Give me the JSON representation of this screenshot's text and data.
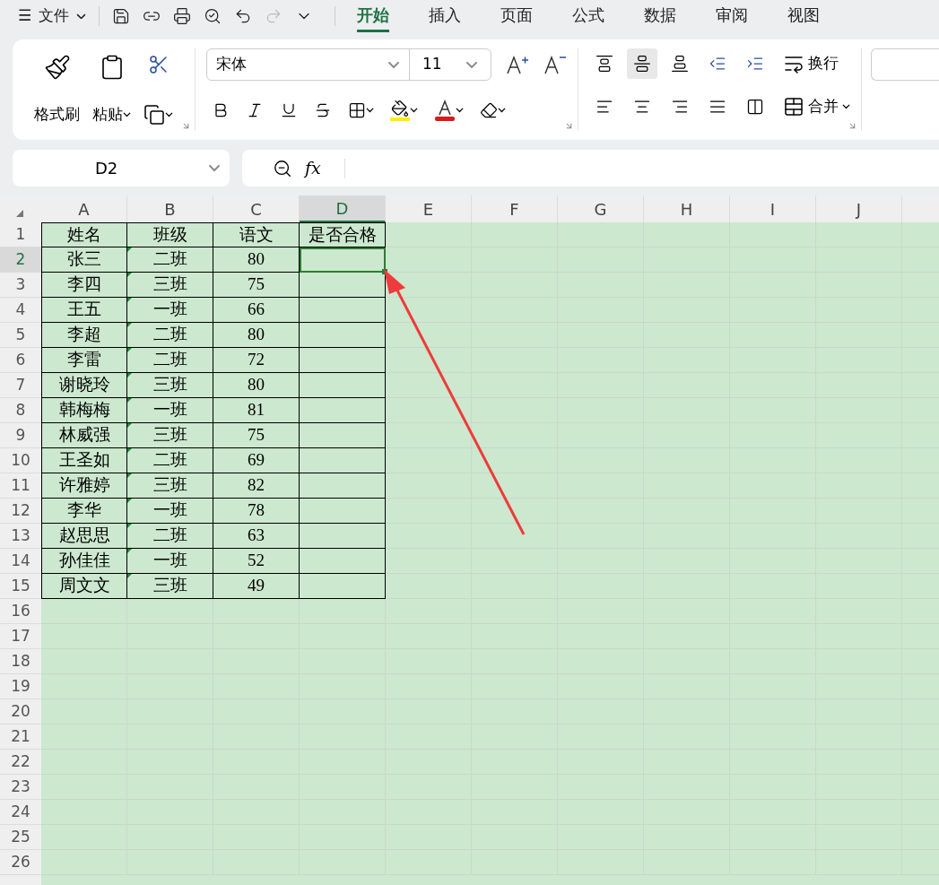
{
  "menu": {
    "menu_glyph": "☰",
    "file_label": "文件"
  },
  "tabs": [
    {
      "label": "开始",
      "selected": true
    },
    {
      "label": "插入",
      "selected": false
    },
    {
      "label": "页面",
      "selected": false
    },
    {
      "label": "公式",
      "selected": false
    },
    {
      "label": "数据",
      "selected": false
    },
    {
      "label": "审阅",
      "selected": false
    },
    {
      "label": "视图",
      "selected": false
    }
  ],
  "ribbon": {
    "format_painter": "格式刷",
    "paste": "粘贴",
    "font_name": "宋体",
    "font_size": "11",
    "wrap": "换行",
    "merge": "合并",
    "align_center_selected": true
  },
  "name_box": "D2",
  "formula_label": "fx",
  "columns": [
    {
      "label": "A",
      "selected": false
    },
    {
      "label": "B",
      "selected": false
    },
    {
      "label": "C",
      "selected": false
    },
    {
      "label": "D",
      "selected": true
    },
    {
      "label": "E",
      "selected": false
    },
    {
      "label": "F",
      "selected": false
    },
    {
      "label": "G",
      "selected": false
    },
    {
      "label": "H",
      "selected": false
    },
    {
      "label": "I",
      "selected": false
    },
    {
      "label": "J",
      "selected": false
    }
  ],
  "header_row": {
    "number": "1",
    "selected": false,
    "cells": [
      "姓名",
      "班级",
      "语文",
      "是否合格"
    ]
  },
  "rows": [
    {
      "number": "2",
      "selected": true,
      "name": "张三",
      "class_name": "二班",
      "score": "80",
      "flagged": true
    },
    {
      "number": "3",
      "selected": false,
      "name": "李四",
      "class_name": "三班",
      "score": "75",
      "flagged": true
    },
    {
      "number": "4",
      "selected": false,
      "name": "王五",
      "class_name": "一班",
      "score": "66",
      "flagged": true
    },
    {
      "number": "5",
      "selected": false,
      "name": "李超",
      "class_name": "二班",
      "score": "80",
      "flagged": true
    },
    {
      "number": "6",
      "selected": false,
      "name": "李雷",
      "class_name": "二班",
      "score": "72",
      "flagged": true
    },
    {
      "number": "7",
      "selected": false,
      "name": "谢晓玲",
      "class_name": "三班",
      "score": "80",
      "flagged": true
    },
    {
      "number": "8",
      "selected": false,
      "name": "韩梅梅",
      "class_name": "一班",
      "score": "81",
      "flagged": true
    },
    {
      "number": "9",
      "selected": false,
      "name": "林威强",
      "class_name": "三班",
      "score": "75",
      "flagged": true
    },
    {
      "number": "10",
      "selected": false,
      "name": "王圣如",
      "class_name": "二班",
      "score": "69",
      "flagged": true
    },
    {
      "number": "11",
      "selected": false,
      "name": "许雅婷",
      "class_name": "三班",
      "score": "82",
      "flagged": true
    },
    {
      "number": "12",
      "selected": false,
      "name": "李华",
      "class_name": "一班",
      "score": "78",
      "flagged": true
    },
    {
      "number": "13",
      "selected": false,
      "name": "赵思思",
      "class_name": "二班",
      "score": "63",
      "flagged": true
    },
    {
      "number": "14",
      "selected": false,
      "name": "孙佳佳",
      "class_name": "一班",
      "score": "52",
      "flagged": true
    },
    {
      "number": "15",
      "selected": false,
      "name": "周文文",
      "class_name": "三班",
      "score": "49",
      "flagged": true
    }
  ],
  "empty_rows": [
    {
      "number": "16"
    },
    {
      "number": "17"
    },
    {
      "number": "18"
    },
    {
      "number": "19"
    },
    {
      "number": "20"
    },
    {
      "number": "21"
    },
    {
      "number": "22"
    },
    {
      "number": "23"
    },
    {
      "number": "24"
    },
    {
      "number": "25"
    },
    {
      "number": "26"
    }
  ]
}
